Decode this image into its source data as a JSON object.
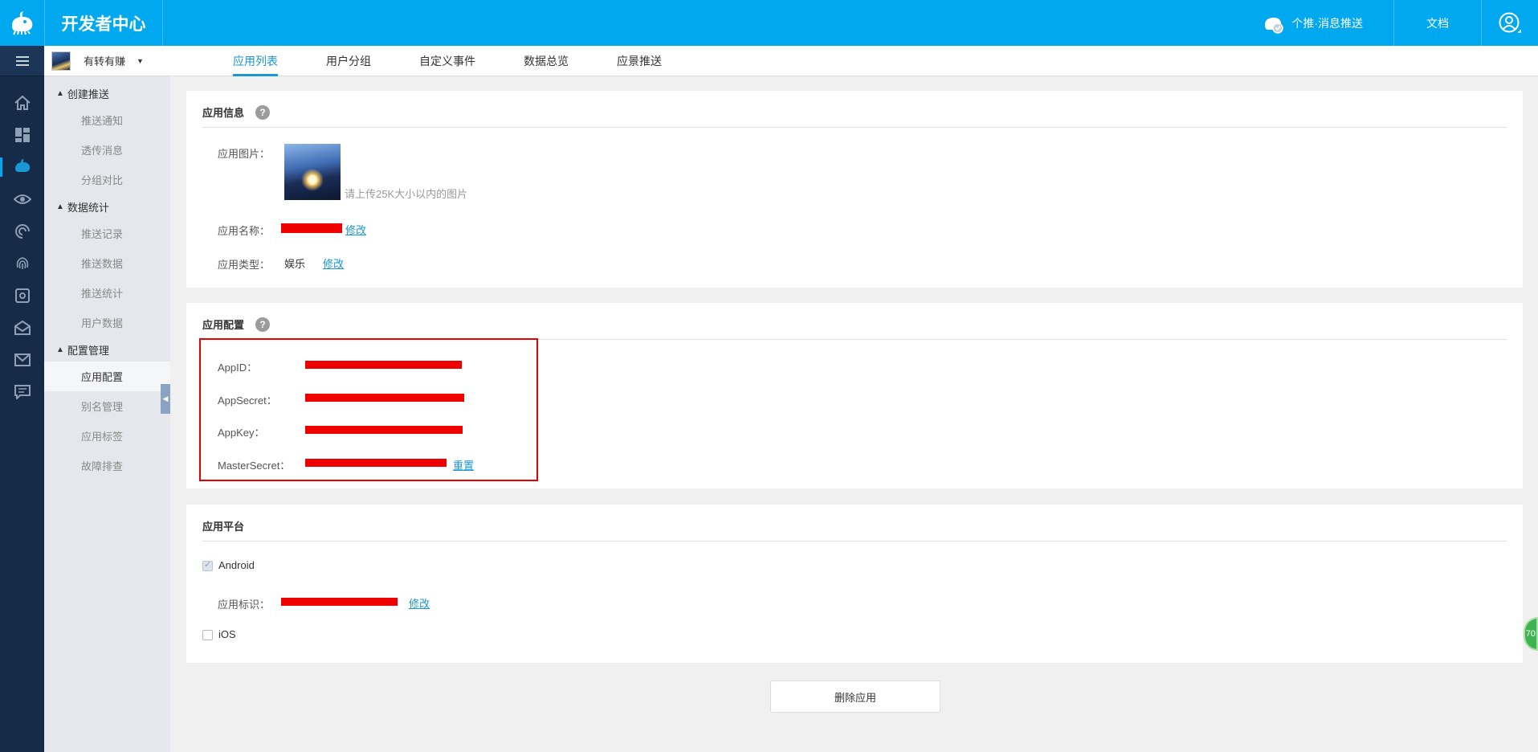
{
  "header": {
    "brand": "开发者中心",
    "product_link": "个推·消息推送",
    "docs": "文档"
  },
  "app_selector": {
    "name": "有转有赚"
  },
  "sidebar": {
    "groups": [
      {
        "title": "创建推送",
        "items": [
          "推送通知",
          "透传消息",
          "分组对比"
        ]
      },
      {
        "title": "数据统计",
        "items": [
          "推送记录",
          "推送数据",
          "推送统计",
          "用户数据"
        ]
      },
      {
        "title": "配置管理",
        "items": [
          "应用配置",
          "别名管理",
          "应用标签",
          "故障排查"
        ]
      }
    ],
    "active_item": "应用配置"
  },
  "tabs": [
    "应用列表",
    "用户分组",
    "自定义事件",
    "数据总览",
    "应景推送"
  ],
  "active_tab": "应用列表",
  "app_info": {
    "title": "应用信息",
    "image_label": "应用图片：",
    "image_hint": "请上传25K大小以内的图片",
    "name_label": "应用名称：",
    "name_edit": "修改",
    "type_label": "应用类型：",
    "type_value": "娱乐",
    "type_edit": "修改"
  },
  "app_config": {
    "title": "应用配置",
    "appid_label": "AppID：",
    "appsecret_label": "AppSecret：",
    "appkey_label": "AppKey：",
    "mastersecret_label": "MasterSecret：",
    "reset": "重置"
  },
  "app_platform": {
    "title": "应用平台",
    "android_label": "Android",
    "android_checked": true,
    "package_label": "应用标识：",
    "package_edit": "修改",
    "ios_label": "iOS",
    "ios_checked": false
  },
  "delete_button": "删除应用",
  "float_badge": "70",
  "colors": {
    "header": "#00a8ef",
    "rail": "#162b48",
    "accent": "#1a98d5",
    "redaction": "#ee0000"
  }
}
